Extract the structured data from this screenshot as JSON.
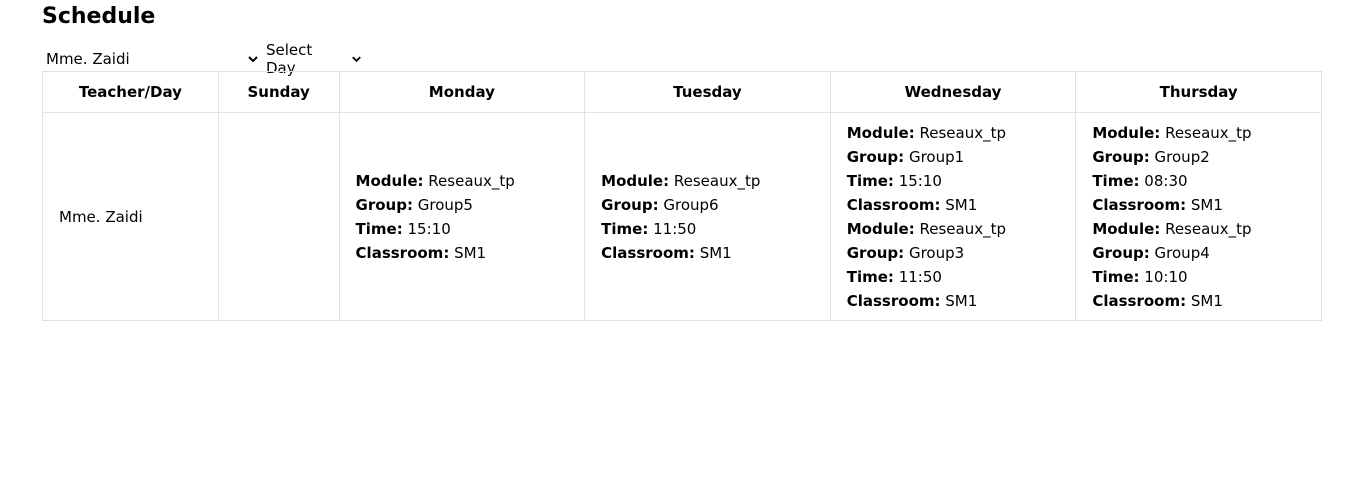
{
  "page": {
    "title": "Schedule"
  },
  "filters": {
    "teacher_selected": "Mme. Zaidi",
    "day_selected": "Select Day"
  },
  "table": {
    "headers": [
      "Teacher/Day",
      "Sunday",
      "Monday",
      "Tuesday",
      "Wednesday",
      "Thursday"
    ],
    "field_labels": {
      "module": "Module:",
      "group": "Group:",
      "time": "Time:",
      "classroom": "Classroom:"
    },
    "rows": [
      {
        "teacher": "Mme. Zaidi",
        "days": {
          "sunday": [],
          "monday": [
            {
              "module": "Reseaux_tp",
              "group": "Group5",
              "time": "15:10",
              "classroom": "SM1"
            }
          ],
          "tuesday": [
            {
              "module": "Reseaux_tp",
              "group": "Group6",
              "time": "11:50",
              "classroom": "SM1"
            }
          ],
          "wednesday": [
            {
              "module": "Reseaux_tp",
              "group": "Group1",
              "time": "15:10",
              "classroom": "SM1"
            },
            {
              "module": "Reseaux_tp",
              "group": "Group3",
              "time": "11:50",
              "classroom": "SM1"
            }
          ],
          "thursday": [
            {
              "module": "Reseaux_tp",
              "group": "Group2",
              "time": "08:30",
              "classroom": "SM1"
            },
            {
              "module": "Reseaux_tp",
              "group": "Group4",
              "time": "10:10",
              "classroom": "SM1"
            }
          ]
        }
      }
    ]
  }
}
